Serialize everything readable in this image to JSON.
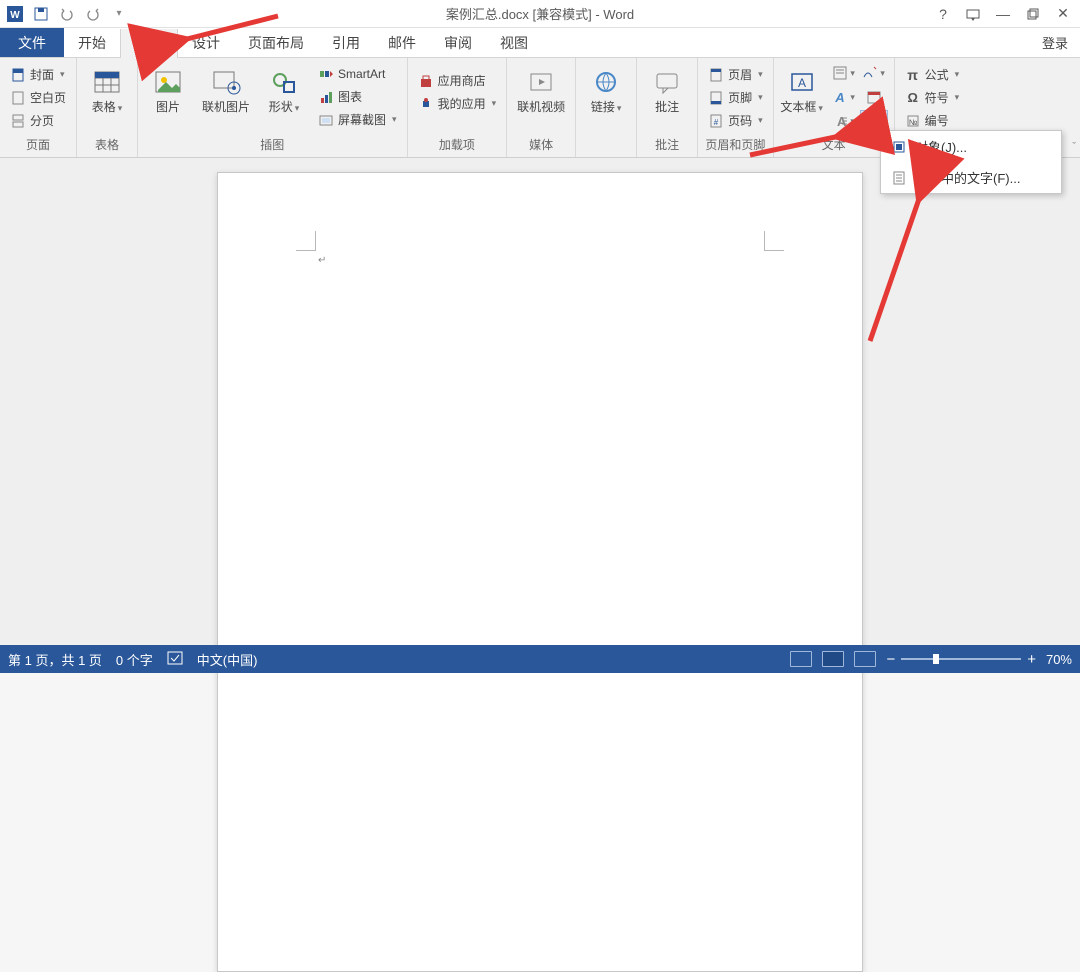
{
  "titlebar": {
    "doc_title": "案例汇总.docx [兼容模式] - Word",
    "word_icon": "W"
  },
  "window_controls": {
    "help": "?",
    "ribbon_opts": "▭",
    "minimize": "—",
    "restore": "◻",
    "close": "✕"
  },
  "tabs": {
    "file": "文件",
    "home": "开始",
    "insert": "插入",
    "design": "设计",
    "layout": "页面布局",
    "references": "引用",
    "mailings": "邮件",
    "review": "审阅",
    "view": "视图",
    "login": "登录"
  },
  "ribbon": {
    "pages": {
      "cover": "封面",
      "blank": "空白页",
      "break": "分页",
      "label": "页面"
    },
    "tables": {
      "btn": "表格",
      "label": "表格"
    },
    "illus": {
      "pictures": "图片",
      "online_pic": "联机图片",
      "shapes": "形状",
      "smartart": "SmartArt",
      "chart": "图表",
      "screenshot": "屏幕截图",
      "label": "插图"
    },
    "apps": {
      "store": "应用商店",
      "myapps": "我的应用",
      "label": "加载项"
    },
    "media": {
      "btn": "联机视频",
      "label": "媒体"
    },
    "links": {
      "btn": "链接",
      "label": ""
    },
    "comments": {
      "btn": "批注",
      "label": "批注"
    },
    "hf": {
      "header": "页眉",
      "footer": "页脚",
      "pagenum": "页码",
      "label": "页眉和页脚"
    },
    "text": {
      "textbox": "文本框",
      "label": "文本"
    },
    "symbols": {
      "equation": "公式",
      "symbol": "符号",
      "number": "编号",
      "label": ""
    }
  },
  "dropdown": {
    "object": "对象(J)...",
    "textfromfile": "文件中的文字(F)..."
  },
  "statusbar": {
    "page": "第 1 页，共 1 页",
    "words": "0 个字",
    "lang": "中文(中国)",
    "zoom": "70%"
  },
  "colors": {
    "accent": "#2a579a",
    "arrow": "#e53935"
  }
}
